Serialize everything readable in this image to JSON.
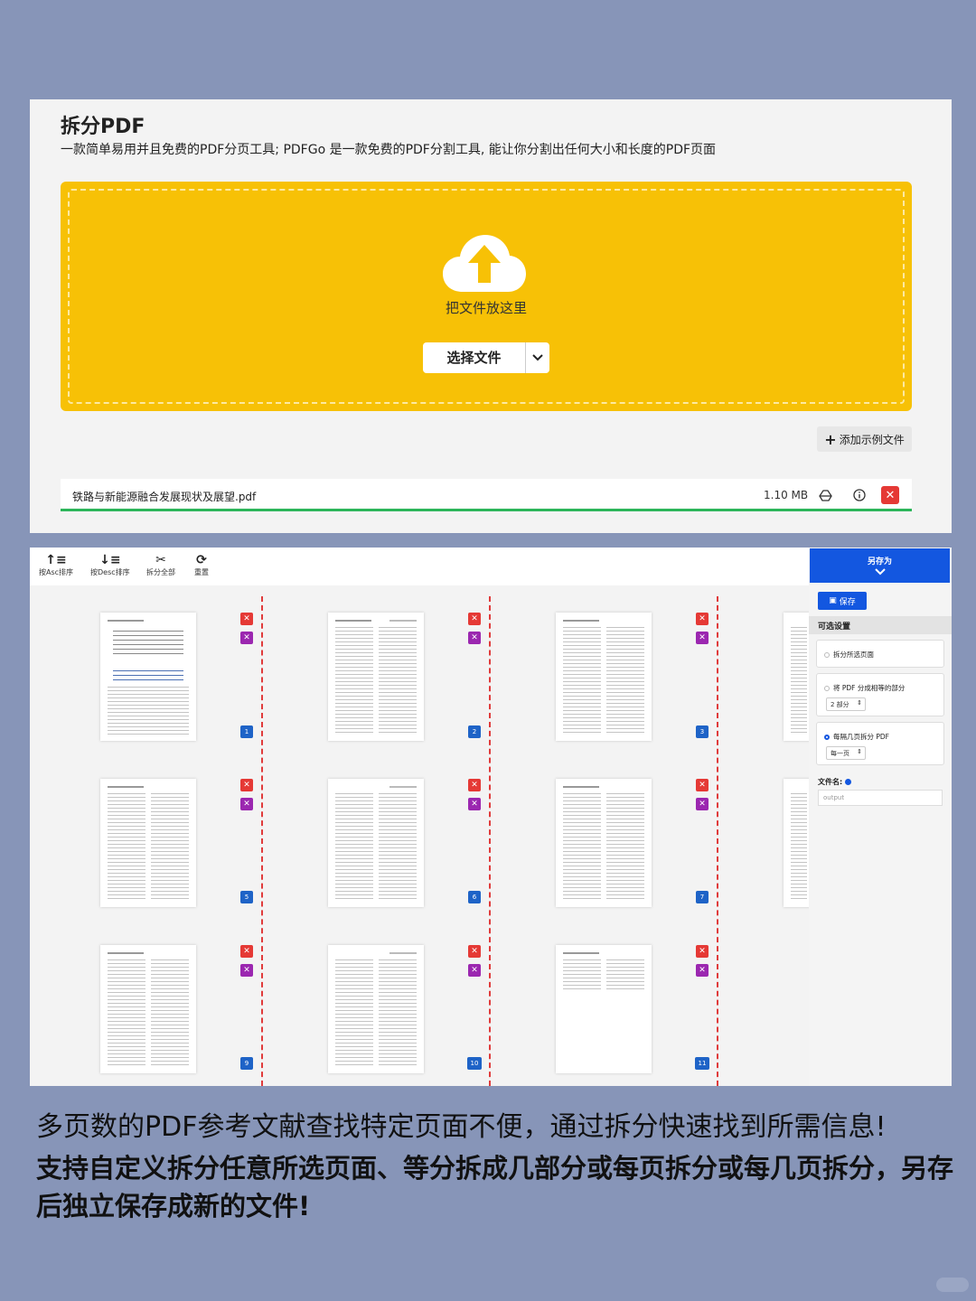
{
  "app": {
    "title": "拆分PDF",
    "subtitle": "一款简单易用并且免费的PDF分页工具; PDFGo 是一款免费的PDF分割工具, 能让你分割出任何大小和长度的PDF页面"
  },
  "dropzone": {
    "label": "把文件放这里",
    "select_button": "选择文件",
    "add_sample": "添加示例文件",
    "icon": "cloud-upload-icon",
    "color": "#f7c106"
  },
  "file": {
    "name": "铁路与新能源融合发展现状及展望.pdf",
    "size": "1.10 MB",
    "progress": 1.0
  },
  "toolbar": {
    "sort_asc": "按Asc排序",
    "sort_desc": "按Desc排序",
    "split_all": "拆分全部",
    "reset": "重置"
  },
  "pages": [
    {
      "number": "1"
    },
    {
      "number": "2"
    },
    {
      "number": "3"
    },
    {
      "number": "5"
    },
    {
      "number": "6"
    },
    {
      "number": "7"
    },
    {
      "number": "9"
    },
    {
      "number": "10"
    },
    {
      "number": "11"
    }
  ],
  "sidebar": {
    "save_as": "另存为",
    "save": "保存",
    "options_title": "可选设置",
    "option_selected_pages": "拆分所选页面",
    "option_equal_parts": "将 PDF 分成相等的部分",
    "equal_parts_value": "2 部分",
    "option_every_n": "每隔几页拆分 PDF",
    "every_n_value": "每一页",
    "filename_label": "文件名:",
    "filename_placeholder": "output",
    "accent": "#1357e0"
  },
  "captions": {
    "line1": "多页数的PDF参考文献查找特定页面不便，通过拆分快速找到所需信息!",
    "line2": "支持自定义拆分任意所选页面、等分拆成几部分或每页拆分或每几页拆分，另存后独立保存成新的文件!"
  }
}
